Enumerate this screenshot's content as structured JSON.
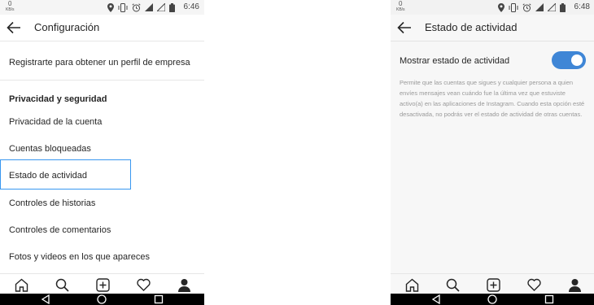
{
  "screens": {
    "left": {
      "status": {
        "speed": "0",
        "speed_unit": "KB/s",
        "time": "6:46"
      },
      "title": "Configuración",
      "menu": {
        "business": "Registrarte para obtener un perfil de empresa",
        "section_header": "Privacidad y seguridad",
        "items": [
          "Privacidad de la cuenta",
          "Cuentas bloqueadas",
          "Estado de actividad",
          "Controles de historias",
          "Controles de comentarios",
          "Fotos y videos en los que apareces"
        ],
        "highlighted_item": "Estado de actividad"
      }
    },
    "right": {
      "status": {
        "speed": "0",
        "speed_unit": "KB/s",
        "time": "6:48"
      },
      "title": "Estado de actividad",
      "setting": {
        "label": "Mostrar estado de actividad",
        "enabled": true,
        "description": "Permite que las cuentas que sigues y cualquier persona a quien envíes mensajes vean cuándo fue la última vez que estuviste activo(a) en las aplicaciones de Instagram. Cuando esta opción esté desactivada, no podrás ver el estado de actividad de otras cuentas."
      }
    }
  },
  "icons": {
    "status": [
      "location-icon",
      "vibrate-icon",
      "alarm-icon",
      "signal-icon",
      "no-signal-icon",
      "battery-icon"
    ],
    "tabs": [
      "home-icon",
      "search-icon",
      "new-post-icon",
      "activity-heart-icon",
      "profile-icon"
    ],
    "system": [
      "back-triangle-icon",
      "home-circle-icon",
      "recents-square-icon"
    ]
  },
  "colors": {
    "highlight": "#3897f0",
    "toggle_on": "#3f86d6",
    "help_text": "#999999"
  }
}
